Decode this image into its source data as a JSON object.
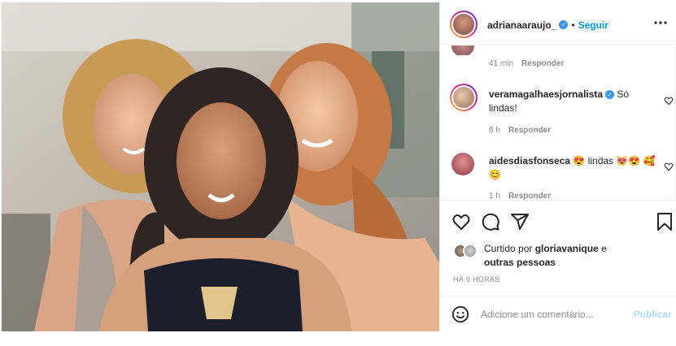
{
  "post": {
    "username": "adrianaaraujo_",
    "follow_label": "Seguir",
    "separator": "•",
    "more_label": "•••"
  },
  "comments": [
    {
      "username": "",
      "text": "",
      "time": "41 min",
      "reply": "Responder"
    },
    {
      "username": "veramagalhaesjornalista",
      "text": "Só lindas!",
      "time": "6 h",
      "reply": "Responder"
    },
    {
      "username": "aidesdiasfonseca",
      "text": "😍 lindas 😻😍 🥰😊",
      "time": "1 h",
      "reply": "Responder"
    }
  ],
  "likes": {
    "prefix": "Curtido por",
    "user": "gloriavanique",
    "suffix": "e",
    "others": "outras pessoas"
  },
  "timestamp": "HÁ 9 HORAS",
  "add_comment": {
    "placeholder": "Adicione um comentário...",
    "publish_label": "Publicar"
  },
  "colors": {
    "accent": "#0095f6",
    "verified": "#3897f0",
    "muted": "#8e8e8e",
    "publish_disabled": "#b2dffc"
  },
  "icons": [
    "verified-badge-icon",
    "more-options-icon",
    "heart-icon",
    "comment-icon",
    "share-icon",
    "bookmark-icon",
    "emoji-icon"
  ]
}
